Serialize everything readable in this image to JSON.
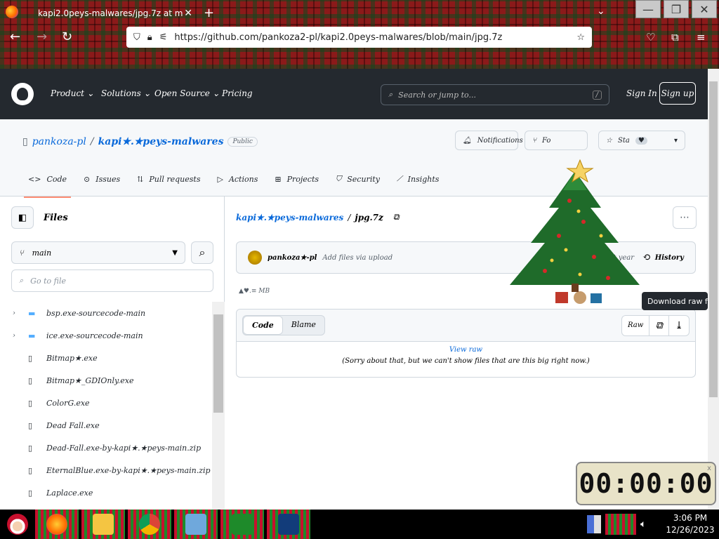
{
  "browser": {
    "tab_title": "kapi2.0peys-malwares/jpg.7z at m",
    "url": "https://github.com/pankoza2-pl/kapi2.0peys-malwares/blob/main/jpg.7z"
  },
  "header": {
    "nav": [
      "Product",
      "Solutions",
      "Open Source",
      "Pricing"
    ],
    "search_placeholder": "Search or jump to...",
    "search_key": "/",
    "sign_in": "Sign In",
    "sign_up": "Sign up"
  },
  "repo": {
    "owner": "pankoza-pl",
    "name": "kapi★.★peys-malwares",
    "visibility": "Public",
    "notifications": "Notifications",
    "fork": "Fo",
    "star": "Sta",
    "tabs": [
      "Code",
      "Issues",
      "Pull requests",
      "Actions",
      "Projects",
      "Security",
      "Insights"
    ]
  },
  "sidebar": {
    "title": "Files",
    "branch": "main",
    "goto_placeholder": "Go to file",
    "items": [
      {
        "name": "bsp.exe-sourcecode-main",
        "type": "folder"
      },
      {
        "name": "ice.exe-sourcecode-main",
        "type": "folder"
      },
      {
        "name": "Bitmap★.exe",
        "type": "file"
      },
      {
        "name": "Bitmap★_GDIOnly.exe",
        "type": "file"
      },
      {
        "name": "ColorG.exe",
        "type": "file"
      },
      {
        "name": "Dead Fall.exe",
        "type": "file"
      },
      {
        "name": "Dead-Fall.exe-by-kapi★.★peys-main.zip",
        "type": "file"
      },
      {
        "name": "EternalBlue.exe-by-kapi★.★peys-main.zip",
        "type": "file"
      },
      {
        "name": "Laplace.exe",
        "type": "file"
      }
    ]
  },
  "main": {
    "breadcrumb_repo": "kapi★.★peys-malwares",
    "breadcrumb_sep": "/",
    "breadcrumb_file": "jpg.7z",
    "commit_author": "pankoza★-pl",
    "commit_message": "Add files via upload",
    "commit_time": "★♥★★★★ · last year",
    "history": "History",
    "file_size": "▲♥.≡ MB",
    "tab_code": "Code",
    "tab_blame": "Blame",
    "raw": "Raw",
    "view_raw": "View raw",
    "too_big": "(Sorry about that, but we can't show files that are this big right now.)",
    "tooltip": "Download raw fi"
  },
  "overlay": {
    "timer": "00:00:00",
    "timer_close": "x"
  },
  "taskbar": {
    "time": "3:06 PM",
    "date": "12/26/2023"
  },
  "colors": {
    "accent": "#0969da",
    "header_bg": "#24292f",
    "active_tab_underline": "#fd8c73"
  }
}
